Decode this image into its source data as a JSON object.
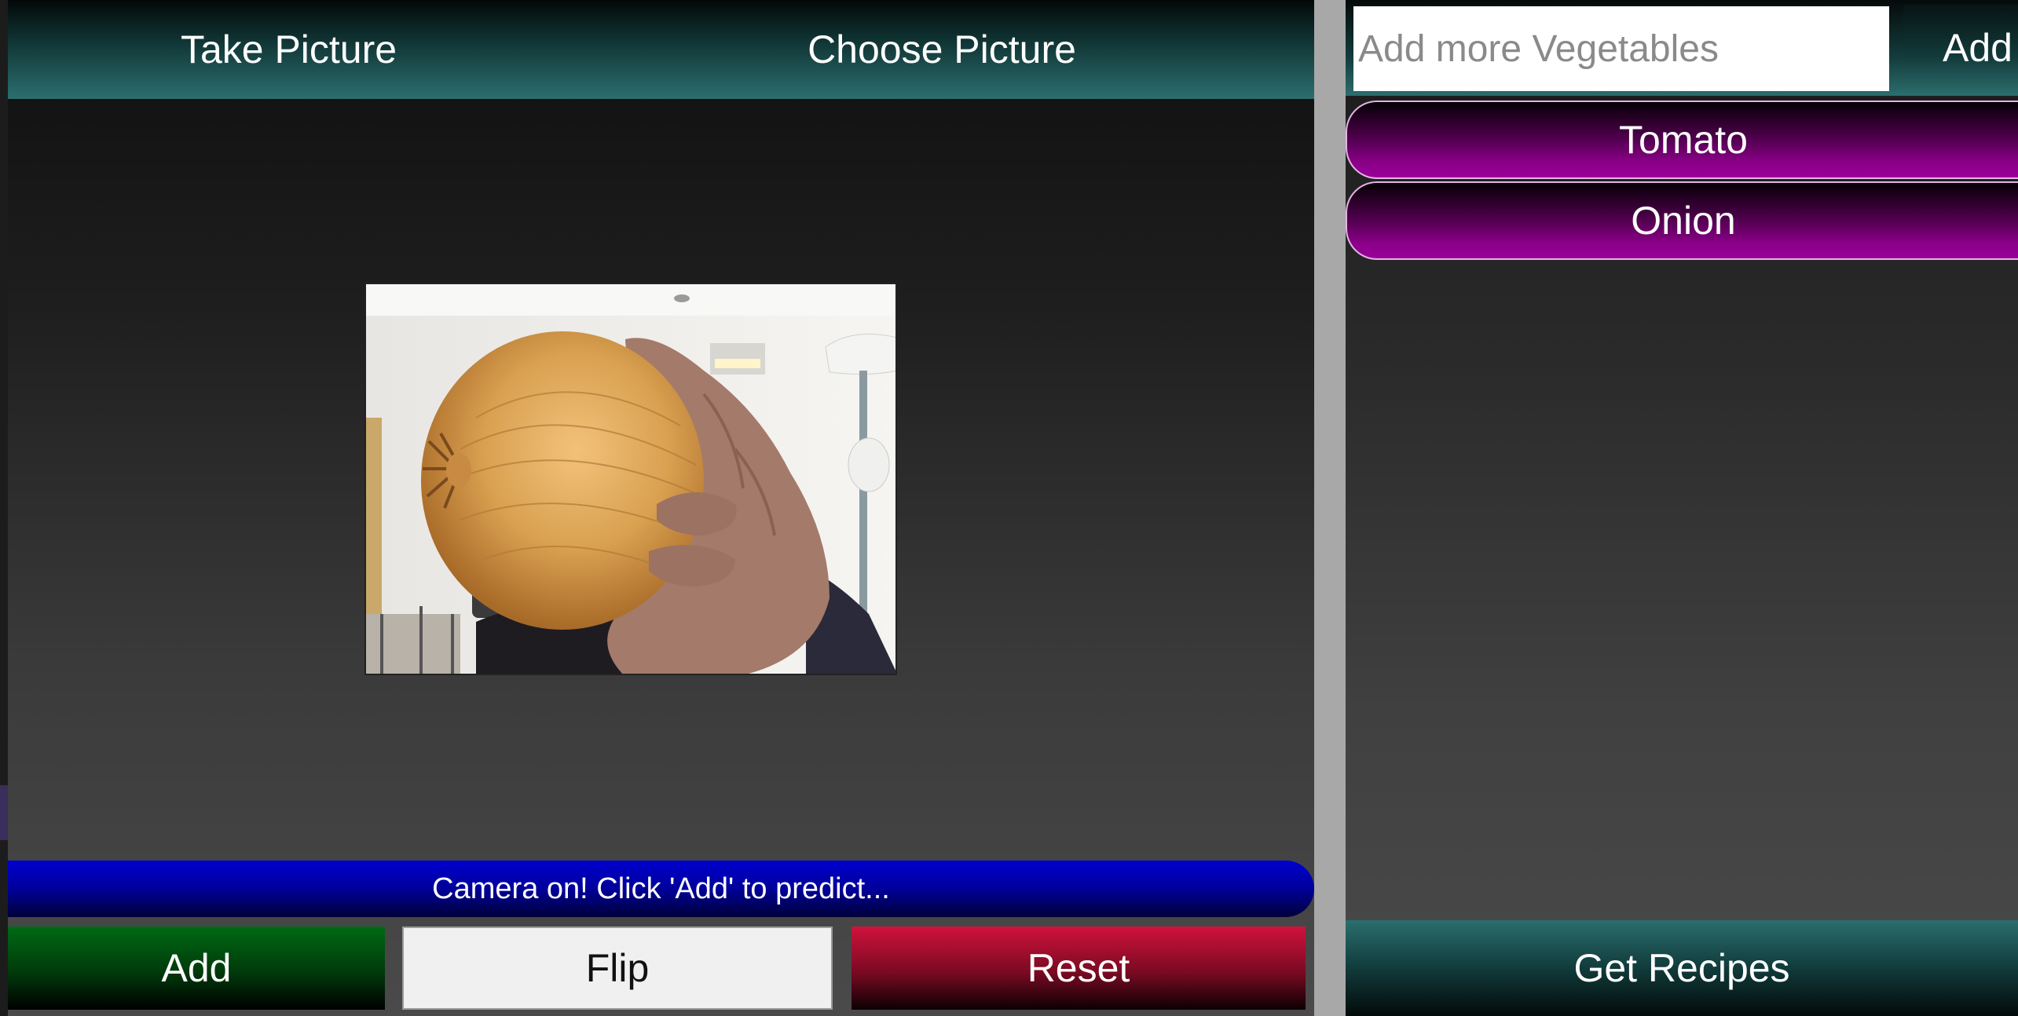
{
  "camera_panel": {
    "take_picture_label": "Take Picture",
    "choose_picture_label": "Choose Picture",
    "status_message": "Camera on! Click 'Add' to predict...",
    "add_label": "Add",
    "flip_label": "Flip",
    "reset_label": "Reset"
  },
  "vegetables_panel": {
    "input_placeholder": "Add more Vegetables",
    "input_value": "",
    "add_label": "Add",
    "items": [
      {
        "label": "Tomato"
      },
      {
        "label": "Onion"
      }
    ],
    "get_recipes_label": "Get Recipes"
  },
  "colors": {
    "header_teal": "#2c6e6e",
    "status_blue": "#0000d0",
    "add_green": "#006a14",
    "reset_red": "#d0123c",
    "item_magenta": "#9a0098"
  }
}
